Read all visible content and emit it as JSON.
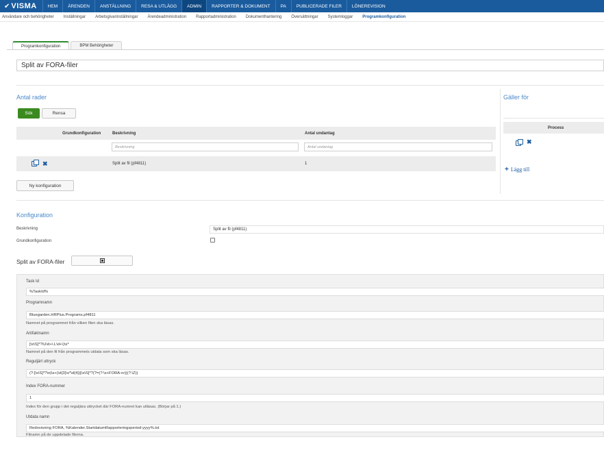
{
  "topnav": {
    "logo": "VISMA",
    "items": [
      "HEM",
      "ÄRENDEN",
      "ANSTÄLLNING",
      "RESA & UTLÄGG",
      "ADMIN",
      "RAPPORTER & DOKUMENT",
      "PA",
      "PUBLICERADE FILER",
      "LÖNEREVISION"
    ],
    "active_index": 4
  },
  "subnav": {
    "items": [
      "Användare och behörigheter",
      "Inställningar",
      "Arbetsgivarinställningar",
      "Ärendeadministration",
      "Rapportadministration",
      "Dokumenthantering",
      "Översättningar",
      "Systemloggar",
      "Programkonfiguration"
    ],
    "active_index": 8
  },
  "tabs": [
    "Programkonfiguration",
    "BPM Behörigheter"
  ],
  "page_title": "Split av FORA-filer",
  "antal_rader": {
    "title": "Antal rader",
    "search_label": "Sök",
    "clear_label": "Rensa",
    "columns": [
      "Grundkonfiguration",
      "Beskrivning",
      "Antal undantag"
    ],
    "filter_placeholders": [
      "Beskrivning",
      "Antal undantag"
    ],
    "rows": [
      {
        "beskrivning": "Split av fil (pf4811)",
        "antal_undantag": "1"
      }
    ],
    "new_config_label": "Ny konfiguration"
  },
  "galler_for": {
    "title": "Gäller för",
    "column": "Process",
    "add_label": "Lägg till"
  },
  "konfiguration": {
    "title": "Konfiguration",
    "beskrivning_label": "Beskrivning",
    "beskrivning_value": "Split av fil (pf4811)",
    "grundkonfiguration_label": "Grundkonfiguration"
  },
  "split": {
    "title": "Split av FORA-filer",
    "fields": [
      {
        "label": "Task Id",
        "value": "%TaskId%",
        "hint": ""
      },
      {
        "label": "Programnamn",
        "value": "Bluegarden.HRPlus.Programs.pf4811",
        "hint": "Namnet på programmet från vilken filen ska läsas."
      },
      {
        "label": "Artifaktnamn",
        "value": "[\\s\\S]*?\\U\\d+\\.L\\d+\\)\\s*",
        "hint": "Namnet på den fil från programmets utdata som ska läsas."
      },
      {
        "label": "Reguljärt uttryck",
        "value": "(?:[\\s\\S]*?\\n|\\s+(\\d{3}\\s*\\d{4})[\\s\\S]*?(?=(?:\\s+FORA-nr)|(?:\\Z))",
        "hint": ""
      },
      {
        "label": "Index FORA-nummer",
        "value": "1",
        "hint": "Index för den grupp i det reguljära uttrycket där FORA-numret kan utläsas. (Börjar på 1.)"
      },
      {
        "label": "Utdata namn",
        "value": "Redovisning FORA, %Kalender.StartdatumRapporteringsperiod:yyyy%.txt",
        "hint": "Filnamn på de uppdelade filerna."
      }
    ]
  },
  "colors": {
    "nav": "#1a5b9e",
    "accent_green": "#3a8a1f",
    "section_title": "#4a89c9"
  }
}
